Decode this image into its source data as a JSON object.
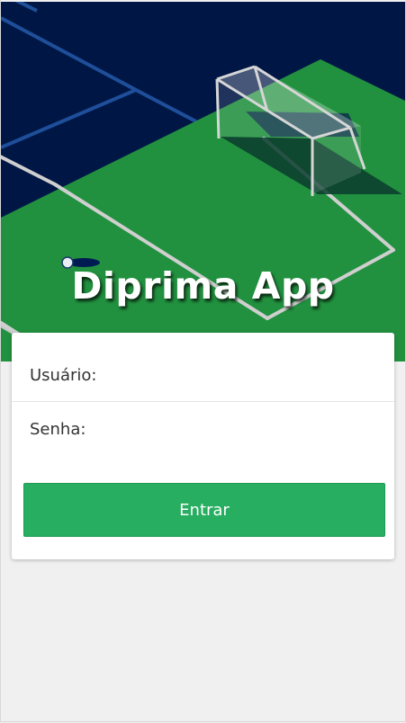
{
  "app": {
    "title": "Diprima App"
  },
  "login": {
    "username_label": "Usuário:",
    "username_value": "",
    "password_label": "Senha:",
    "password_value": "",
    "submit_label": "Entrar"
  },
  "colors": {
    "sky": "#001746",
    "field_green": "#21913f",
    "button_green": "#27ae60",
    "background": "#f0f0f0"
  }
}
